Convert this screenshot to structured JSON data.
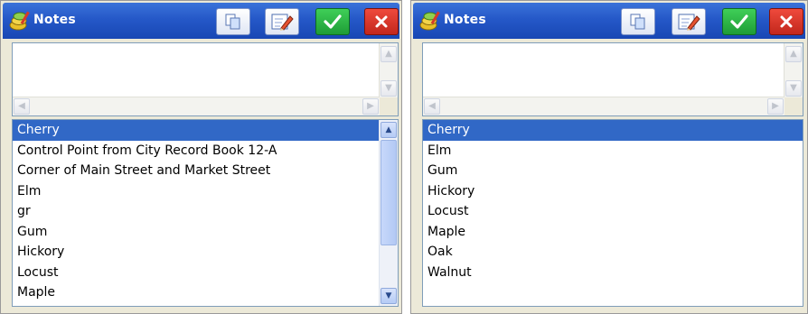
{
  "left": {
    "title": "Notes",
    "items": [
      "Cherry",
      "Control Point from City Record Book 12-A",
      "Corner of Main Street and Market Street",
      "Elm",
      "gr",
      "Gum",
      "Hickory",
      "Locust",
      "Maple"
    ],
    "selected_index": 0
  },
  "right": {
    "title": "Notes",
    "items": [
      "Cherry",
      "Elm",
      "Gum",
      "Hickory",
      "Locust",
      "Maple",
      "Oak",
      "Walnut"
    ],
    "selected_index": 0
  },
  "icons": {
    "app": "notes-app-icon",
    "copy": "copy-icon",
    "edit": "edit-note-icon",
    "ok": "checkmark-icon",
    "cancel": "close-icon"
  },
  "colors": {
    "title_bar": "#2558c8",
    "selection": "#3168c6",
    "ok_button": "#1e9c36",
    "cancel_button": "#c2271c"
  }
}
